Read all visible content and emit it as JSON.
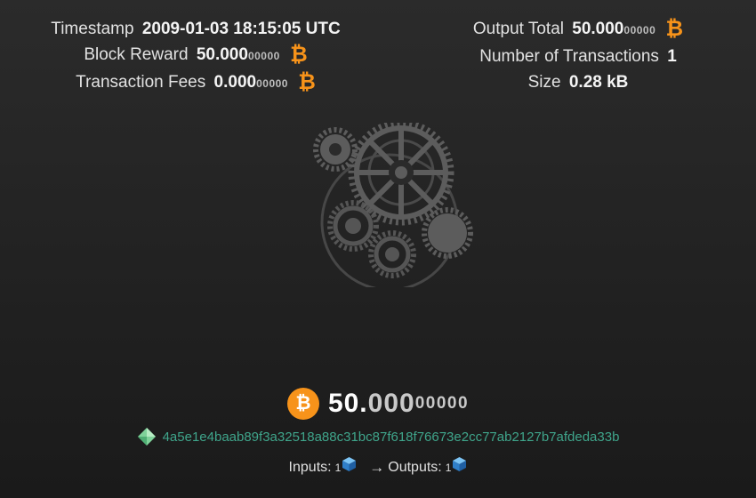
{
  "stats_left": {
    "timestamp_label": "Timestamp",
    "timestamp_value": "2009-01-03 18:15:05 UTC",
    "block_reward_label": "Block Reward",
    "block_reward_main": "50.000",
    "block_reward_sats": "00000",
    "fees_label": "Transaction Fees",
    "fees_main": "0.000",
    "fees_sats": "00000"
  },
  "stats_right": {
    "output_total_label": "Output Total",
    "output_total_main": "50.000",
    "output_total_sats": "00000",
    "tx_count_label": "Number of Transactions",
    "tx_count_value": "1",
    "size_label": "Size",
    "size_value": "0.28 kB"
  },
  "currency_symbol": "₿",
  "amount": {
    "main": "50.",
    "decimals": "000",
    "sats": "00000"
  },
  "transaction": {
    "hash": "4a5e1e4baab89f3a32518a88c31bc87f618f76673e2cc77ab2127b7afdeda33b"
  },
  "io": {
    "inputs_label": "Inputs:",
    "inputs_count": "1",
    "arrow": "→",
    "outputs_label": "Outputs:",
    "outputs_count": "1"
  },
  "icons": {
    "btc": "bitcoin-icon",
    "tx": "diamond-icon",
    "io": "cube-icon",
    "art": "gears-icon"
  },
  "colors": {
    "btc_orange": "#f7931a",
    "hash_green": "#3fa58b",
    "gear_gray": "#5a5a5a",
    "cube_blue": "#3a8fd8"
  }
}
